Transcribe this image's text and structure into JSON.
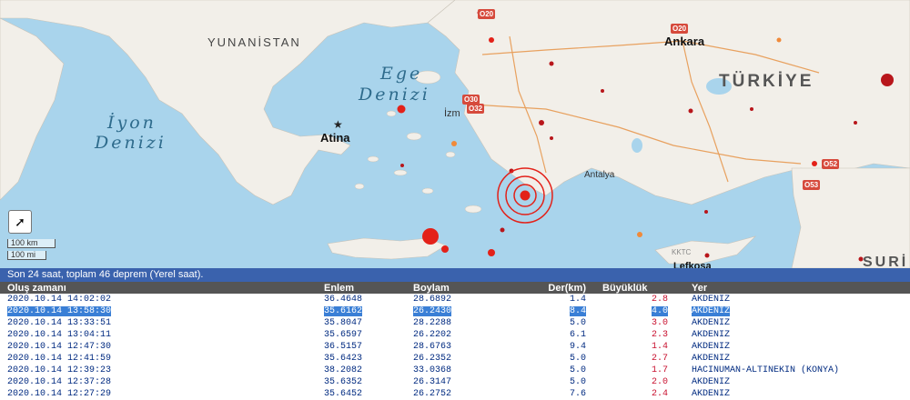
{
  "map": {
    "labels": {
      "yunanistan": "YUNANİSTAN",
      "ege_1": "Ege",
      "ege_2": "Denizi",
      "iyon_1": "İyon",
      "iyon_2": "Denizi",
      "turkiye": "TÜRKİYE",
      "ankara": "Ankara",
      "atina": "Atina",
      "antalya": "Antalya",
      "lefkosa": "Lefkoşa",
      "kktc": "KKTC",
      "suriye": "SURİ",
      "izmir": "İzm"
    },
    "roads": [
      "O20",
      "O30",
      "O32",
      "O52",
      "O53",
      "O20"
    ],
    "scale": {
      "km": "100 km",
      "mi": "100 mi"
    },
    "fullscreen_icon": "arrow-diagonal-icon",
    "colors": {
      "sea": "#a9d4ec",
      "land": "#f2efe9",
      "quake_red": "#e32119",
      "quake_dark": "#b8161b",
      "quake_orange": "#f08a3a"
    }
  },
  "list": {
    "header": "Son 24 saat, toplam 46 deprem (Yerel saat).",
    "columns": [
      "Oluş zamanı",
      "Enlem",
      "Boylam",
      "Der(km)",
      "Büyüklük",
      "Yer"
    ],
    "rows": [
      {
        "time": "2020.10.14 14:02:02",
        "lat": "36.4648",
        "lon": "28.6892",
        "depth": "1.4",
        "mag": "2.8",
        "place": "AKDENIZ"
      },
      {
        "time": "2020.10.14 13:58:30",
        "lat": "35.6162",
        "lon": "26.2430",
        "depth": "8.4",
        "mag": "4.0",
        "place": "AKDENIZ"
      },
      {
        "time": "2020.10.14 13:33:51",
        "lat": "35.8047",
        "lon": "28.2288",
        "depth": "5.0",
        "mag": "3.0",
        "place": "AKDENIZ"
      },
      {
        "time": "2020.10.14 13:04:11",
        "lat": "35.6597",
        "lon": "26.2202",
        "depth": "6.1",
        "mag": "2.3",
        "place": "AKDENIZ"
      },
      {
        "time": "2020.10.14 12:47:30",
        "lat": "36.5157",
        "lon": "28.6763",
        "depth": "9.4",
        "mag": "1.4",
        "place": "AKDENIZ"
      },
      {
        "time": "2020.10.14 12:41:59",
        "lat": "35.6423",
        "lon": "26.2352",
        "depth": "5.0",
        "mag": "2.7",
        "place": "AKDENIZ"
      },
      {
        "time": "2020.10.14 12:39:23",
        "lat": "38.2082",
        "lon": "33.0368",
        "depth": "5.0",
        "mag": "1.7",
        "place": "HACINUMAN-ALTINEKIN (KONYA)"
      },
      {
        "time": "2020.10.14 12:37:28",
        "lat": "35.6352",
        "lon": "26.3147",
        "depth": "5.0",
        "mag": "2.0",
        "place": "AKDENIZ"
      },
      {
        "time": "2020.10.14 12:27:29",
        "lat": "35.6452",
        "lon": "26.2752",
        "depth": "7.6",
        "mag": "2.4",
        "place": "AKDENIZ"
      }
    ],
    "selected_row": 1
  }
}
